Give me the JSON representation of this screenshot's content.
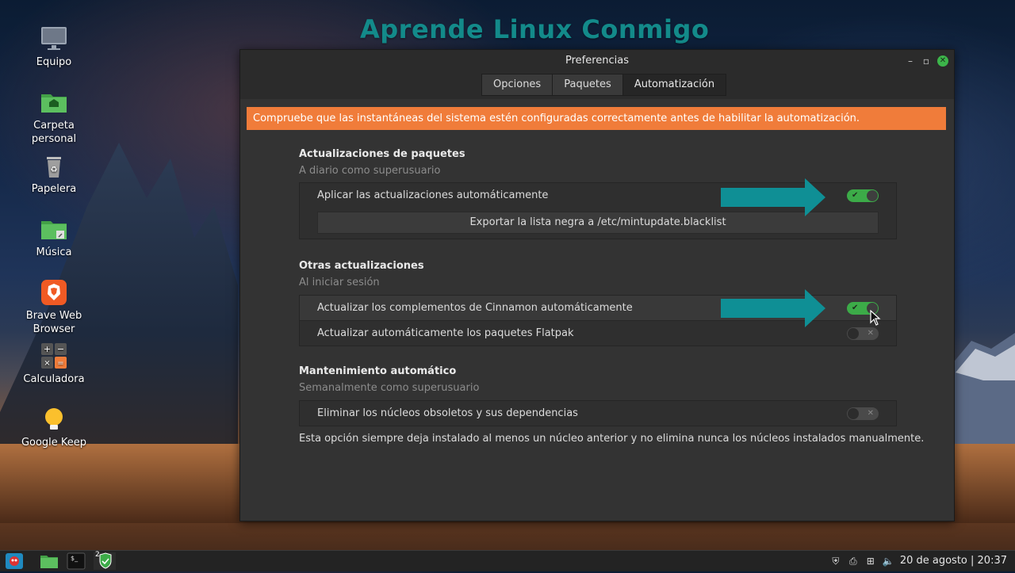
{
  "watermark": "Aprende Linux Conmigo",
  "desktop": {
    "icons": [
      {
        "label": "Equipo",
        "icon": "computer-icon"
      },
      {
        "label": "Carpeta\npersonal",
        "icon": "home-folder-icon"
      },
      {
        "label": "Papelera",
        "icon": "trash-icon"
      },
      {
        "label": "Música",
        "icon": "music-folder-icon"
      },
      {
        "label": "Brave Web\nBrowser",
        "icon": "brave-icon"
      },
      {
        "label": "Calculadora",
        "icon": "calculator-icon"
      },
      {
        "label": "Google Keep",
        "icon": "keep-icon"
      }
    ]
  },
  "window": {
    "title": "Preferencias",
    "tabs": [
      {
        "label": "Opciones",
        "active": false
      },
      {
        "label": "Paquetes",
        "active": false
      },
      {
        "label": "Automatización",
        "active": true
      }
    ],
    "banner": "Compruebe que las instantáneas del sistema estén configuradas correctamente antes de habilitar la automatización.",
    "sections": {
      "packages": {
        "title": "Actualizaciones de paquetes",
        "subtitle": "A diario como superusuario",
        "auto_update_label": "Aplicar las actualizaciones automáticamente",
        "auto_update_on": true,
        "export_button": "Exportar la lista negra a /etc/mintupdate.blacklist"
      },
      "other": {
        "title": "Otras actualizaciones",
        "subtitle": "Al iniciar sesión",
        "cinnamon_label": "Actualizar los complementos de Cinnamon automáticamente",
        "cinnamon_on": true,
        "flatpak_label": "Actualizar automáticamente los paquetes Flatpak",
        "flatpak_on": false
      },
      "maintenance": {
        "title": "Mantenimiento automático",
        "subtitle": "Semanalmente como superusuario",
        "kernels_label": "Eliminar los núcleos obsoletos y sus dependencias",
        "kernels_on": false,
        "note": "Esta opción siempre deja instalado al menos un núcleo anterior y no elimina nunca los núcleos instalados manualmente."
      }
    }
  },
  "taskbar": {
    "clock": "20 de agosto | 20:37",
    "workspace_badge": "2"
  },
  "colors": {
    "accent_green": "#3cab48",
    "banner_orange": "#f07c3a",
    "arrow_teal": "#0f8f95",
    "watermark_teal": "#138a8a"
  }
}
